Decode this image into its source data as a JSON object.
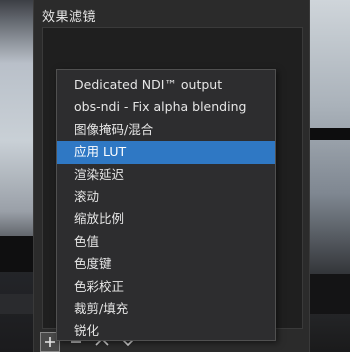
{
  "panel": {
    "title": "效果滤镜"
  },
  "menu": {
    "items": [
      {
        "label": "Dedicated NDI™ output",
        "selected": false
      },
      {
        "label": "obs-ndi - Fix alpha blending",
        "selected": false
      },
      {
        "label": "图像掩码/混合",
        "selected": false
      },
      {
        "label": "应用 LUT",
        "selected": true
      },
      {
        "label": "渲染延迟",
        "selected": false
      },
      {
        "label": "滚动",
        "selected": false
      },
      {
        "label": "缩放比例",
        "selected": false
      },
      {
        "label": "色值",
        "selected": false
      },
      {
        "label": "色度键",
        "selected": false
      },
      {
        "label": "色彩校正",
        "selected": false
      },
      {
        "label": "裁剪/填充",
        "selected": false
      },
      {
        "label": "锐化",
        "selected": false
      }
    ],
    "highlight_color": "#2f78c4"
  },
  "toolbar": {
    "icons": [
      "plus-icon",
      "minus-icon",
      "chevron-up-icon",
      "chevron-down-icon"
    ]
  }
}
